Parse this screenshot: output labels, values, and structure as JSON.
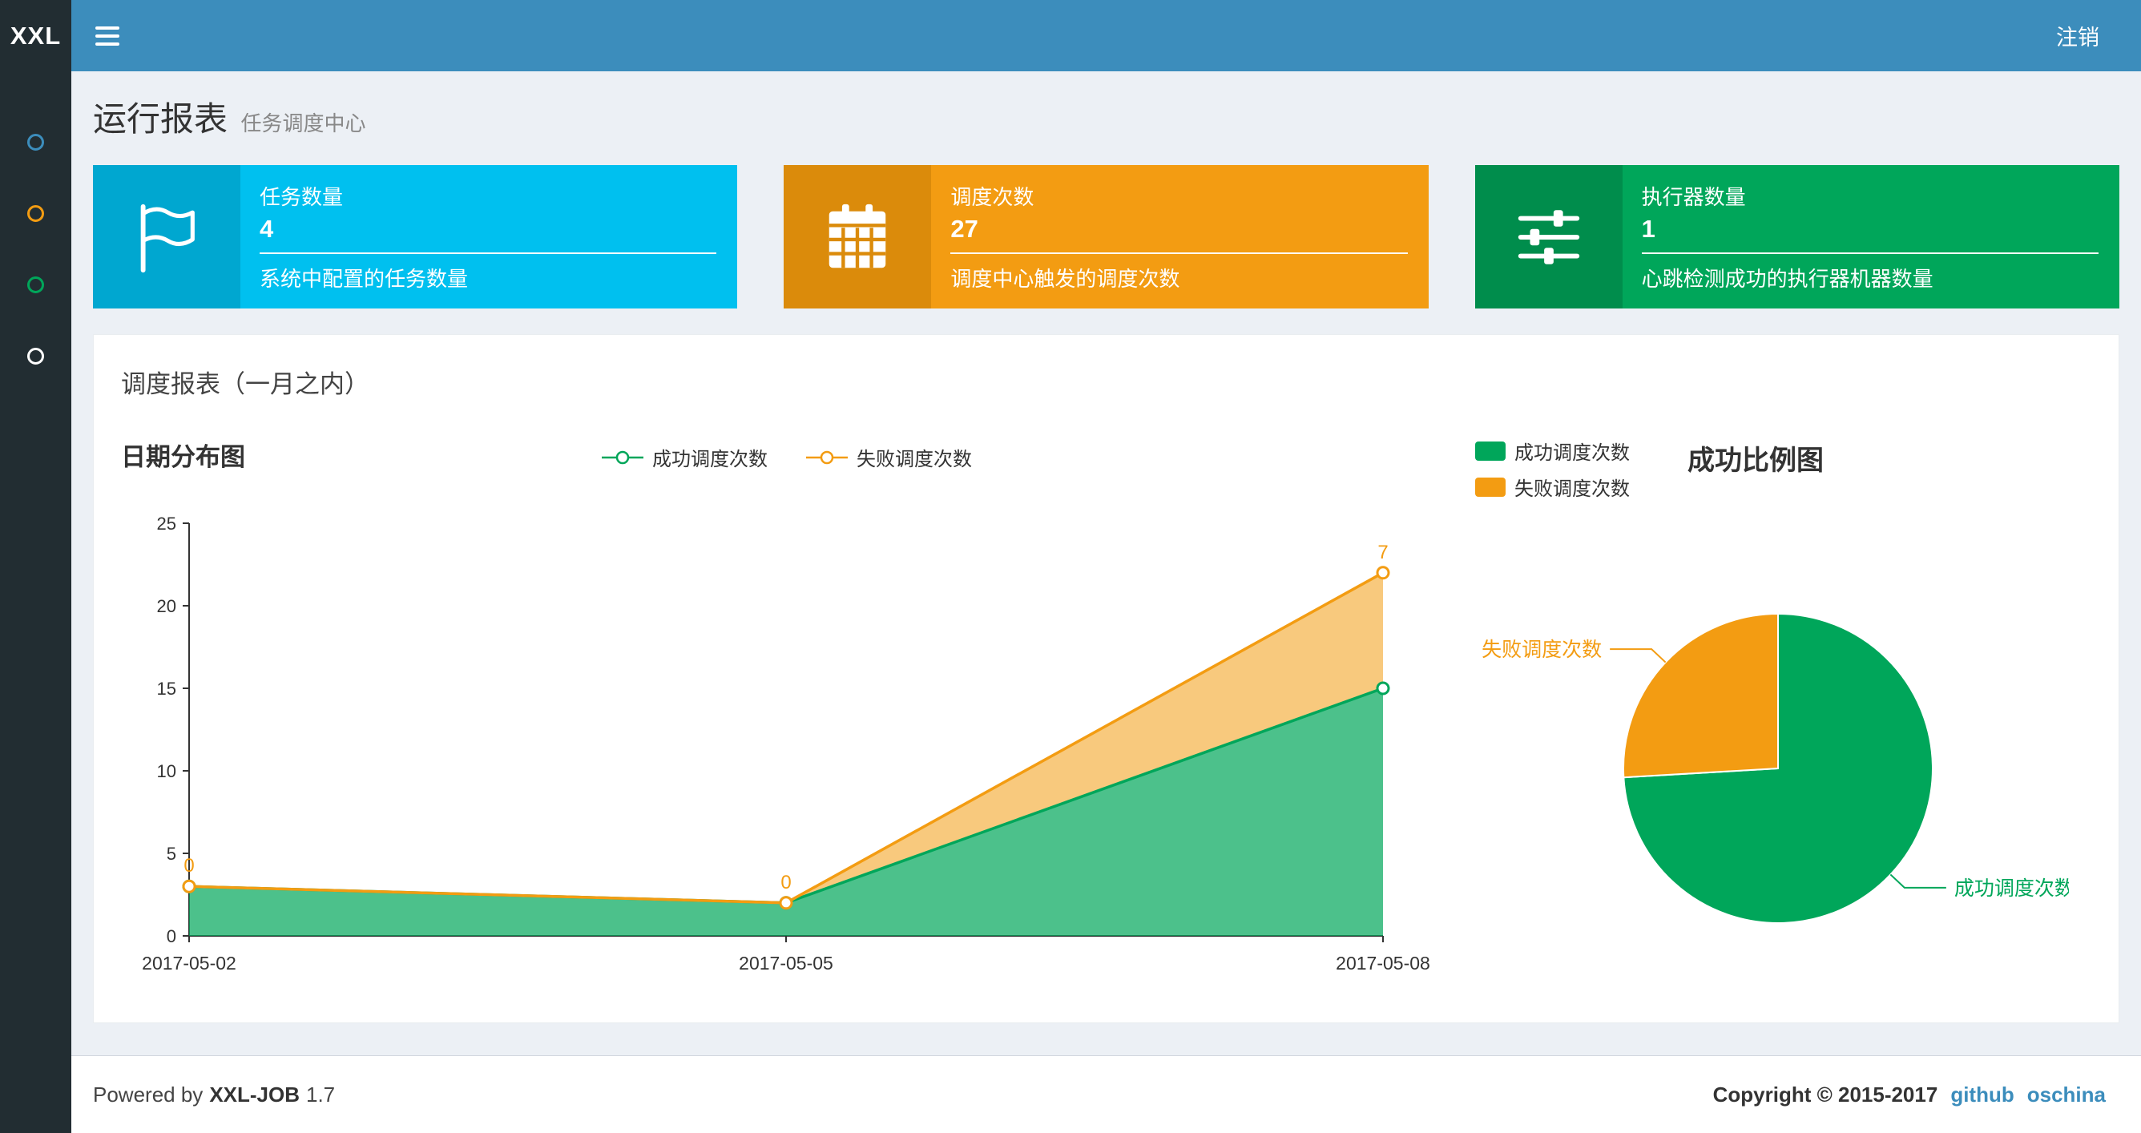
{
  "navbar": {
    "logo": "XXL",
    "logout": "注销"
  },
  "sidebar": {
    "items": [
      {
        "name": "running-report",
        "color": "#3c8dbc"
      },
      {
        "name": "job-manage",
        "color": "#f39c12"
      },
      {
        "name": "executor-manage",
        "color": "#00a65a"
      },
      {
        "name": "help",
        "color": "#ffffff"
      }
    ]
  },
  "page": {
    "title": "运行报表",
    "subtitle": "任务调度中心"
  },
  "info_boxes": [
    {
      "icon": "flag-icon",
      "label": "任务数量",
      "value": "4",
      "desc": "系统中配置的任务数量",
      "color": "#00c0ef",
      "icon_color": "#00a7d0"
    },
    {
      "icon": "calendar-icon",
      "label": "调度次数",
      "value": "27",
      "desc": "调度中心触发的调度次数",
      "color": "#f39c12",
      "icon_color": "#db8b0b"
    },
    {
      "icon": "sliders-icon",
      "label": "执行器数量",
      "value": "1",
      "desc": "心跳检测成功的执行器机器数量",
      "color": "#00a65a",
      "icon_color": "#008d4c"
    }
  ],
  "panel": {
    "title": "调度报表（一月之内）"
  },
  "chart_data": [
    {
      "type": "area",
      "title": "日期分布图",
      "stacked": true,
      "x": [
        "2017-05-02",
        "2017-05-05",
        "2017-05-08"
      ],
      "series": [
        {
          "name": "成功调度次数",
          "color": "#00a65a",
          "values": [
            3,
            2,
            15
          ]
        },
        {
          "name": "失败调度次数",
          "color": "#f39c12",
          "values": [
            0,
            0,
            7
          ]
        }
      ],
      "ylim": [
        0,
        25
      ],
      "yticks": [
        0,
        5,
        10,
        15,
        20,
        25
      ],
      "legend_position": "top-center",
      "grid": false,
      "point_labels": "失败调度次数 stacked totals annotated with fail values 0 / 0 / 7"
    },
    {
      "type": "pie",
      "title": "成功比例图",
      "slices": [
        {
          "name": "成功调度次数",
          "value": 20,
          "color": "#00a65a"
        },
        {
          "name": "失败调度次数",
          "value": 7,
          "color": "#f39c12"
        }
      ],
      "legend_position": "top-left"
    }
  ],
  "footer": {
    "powered": "Powered by",
    "brand": "XXL-JOB",
    "version": "1.7",
    "copyright": "Copyright © 2015-2017",
    "links": [
      "github",
      "oschina"
    ]
  }
}
